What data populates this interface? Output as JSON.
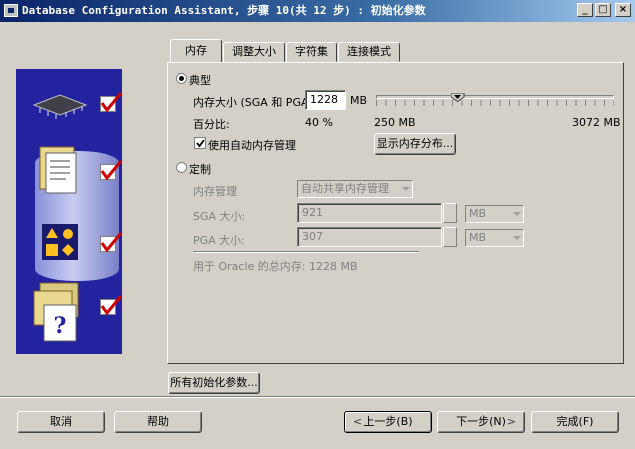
{
  "window": {
    "title": "Database Configuration Assistant, 步骤 10(共 12 步) : 初始化参数",
    "controls": [
      "minimize",
      "maximize",
      "close"
    ]
  },
  "tabs": [
    {
      "label": "内存",
      "active": true
    },
    {
      "label": "调整大小",
      "active": false
    },
    {
      "label": "字符集",
      "active": false
    },
    {
      "label": "连接模式",
      "active": false
    }
  ],
  "memory": {
    "typical": {
      "radio_label": "典型",
      "selected": true,
      "size_label": "内存大小 (SGA 和 PGA):",
      "size_value": "1228",
      "size_unit": "MB",
      "percent_label": "百分比:",
      "percent_value": "40 %",
      "slider_min": "250 MB",
      "slider_max": "3072 MB",
      "slider_value_mb": 1228,
      "auto_mgmt_label": "使用自动内存管理",
      "auto_mgmt_checked": true,
      "show_dist_button": "显示内存分布..."
    },
    "custom": {
      "radio_label": "定制",
      "selected": false,
      "mgmt_label": "内存管理",
      "mgmt_value": "自动共享内存管理",
      "sga_label": "SGA 大小:",
      "sga_value": "921",
      "sga_unit": "MB",
      "pga_label": "PGA 大小:",
      "pga_value": "307",
      "pga_unit": "MB",
      "total_text": "用于 Oracle 的总内存:  1228 MB"
    }
  },
  "all_params_button": "所有初始化参数...",
  "footer": {
    "cancel": "取消",
    "help": "帮助",
    "back": "上一步(B)",
    "next": "下一步(N)",
    "finish": "完成(F)"
  },
  "colors": {
    "titlebar_start": "#0a246a",
    "titlebar_end": "#a6caf0",
    "panel_bg": "#d4d0c8",
    "left_panel": "#2323a0",
    "check_mark": "#cc0000"
  }
}
